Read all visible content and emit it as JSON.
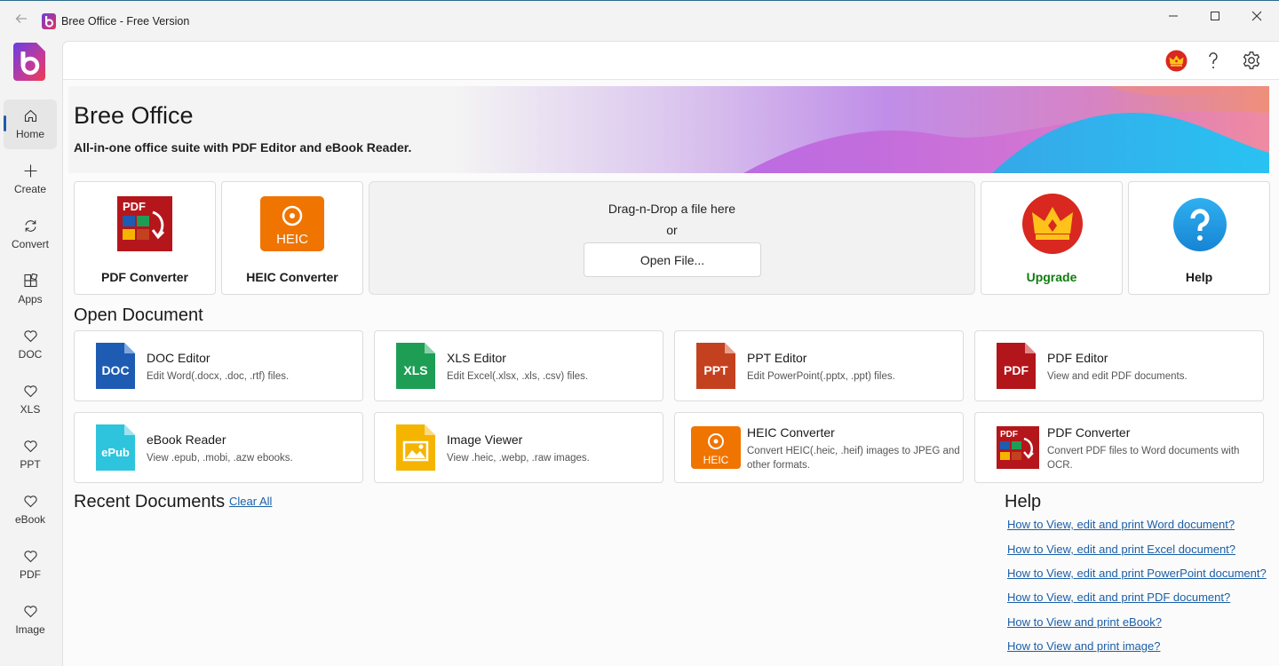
{
  "window": {
    "title": "Bree Office - Free Version"
  },
  "nav": [
    {
      "label": "Home",
      "icon": "home-icon"
    },
    {
      "label": "Create",
      "icon": "plus-icon"
    },
    {
      "label": "Convert",
      "icon": "refresh-icon"
    },
    {
      "label": "Apps",
      "icon": "apps-icon"
    },
    {
      "label": "DOC",
      "icon": "heart-icon"
    },
    {
      "label": "XLS",
      "icon": "heart-icon"
    },
    {
      "label": "PPT",
      "icon": "heart-icon"
    },
    {
      "label": "eBook",
      "icon": "heart-icon"
    },
    {
      "label": "PDF",
      "icon": "heart-icon"
    },
    {
      "label": "Image",
      "icon": "heart-icon"
    }
  ],
  "hero": {
    "title": "Bree Office",
    "subtitle": "All-in-one office suite with PDF Editor and eBook Reader."
  },
  "quick": {
    "pdf_converter": "PDF Converter",
    "heic_converter": "HEIC Converter",
    "drop_text": "Drag-n-Drop a file here",
    "or_text": "or",
    "open_file": "Open File...",
    "upgrade": "Upgrade",
    "help": "Help"
  },
  "icon_text": {
    "pdf": "PDF",
    "doc": "DOC",
    "xls": "XLS",
    "ppt": "PPT",
    "heic": "HEIC",
    "epub": "ePub"
  },
  "open_document": {
    "title": "Open Document",
    "items": [
      {
        "title": "DOC Editor",
        "desc": "Edit Word(.docx, .doc, .rtf) files."
      },
      {
        "title": "XLS Editor",
        "desc": "Edit Excel(.xlsx, .xls, .csv) files."
      },
      {
        "title": "PPT Editor",
        "desc": "Edit PowerPoint(.pptx, .ppt) files."
      },
      {
        "title": "PDF Editor",
        "desc": "View and edit PDF documents."
      },
      {
        "title": "eBook Reader",
        "desc": "View .epub, .mobi, .azw ebooks."
      },
      {
        "title": "Image Viewer",
        "desc": "View .heic, .webp, .raw images."
      },
      {
        "title": "HEIC Converter",
        "desc": "Convert HEIC(.heic, .heif) images to JPEG and other formats."
      },
      {
        "title": "PDF Converter",
        "desc": "Convert PDF files to Word documents with OCR."
      }
    ]
  },
  "recent": {
    "title": "Recent Documents",
    "clear_all": "Clear All"
  },
  "help": {
    "title": "Help",
    "links": [
      "How to View, edit and print Word document?",
      "How to View, edit and print Excel document?",
      "How to View, edit and print PowerPoint document?",
      "How to View, edit and print PDF document?",
      "How to View and print eBook?",
      "How to View and print image?"
    ]
  },
  "colors": {
    "accent": "#1b5fa8",
    "upgrade_green": "#107c10",
    "doc_blue": "#1e5cb3",
    "xls_green": "#1e9e55",
    "ppt_orange": "#c4411f",
    "pdf_red": "#b2151a",
    "epub_cyan": "#2ec4dd",
    "image_yellow": "#f4b400",
    "heic_orange": "#f07400"
  }
}
